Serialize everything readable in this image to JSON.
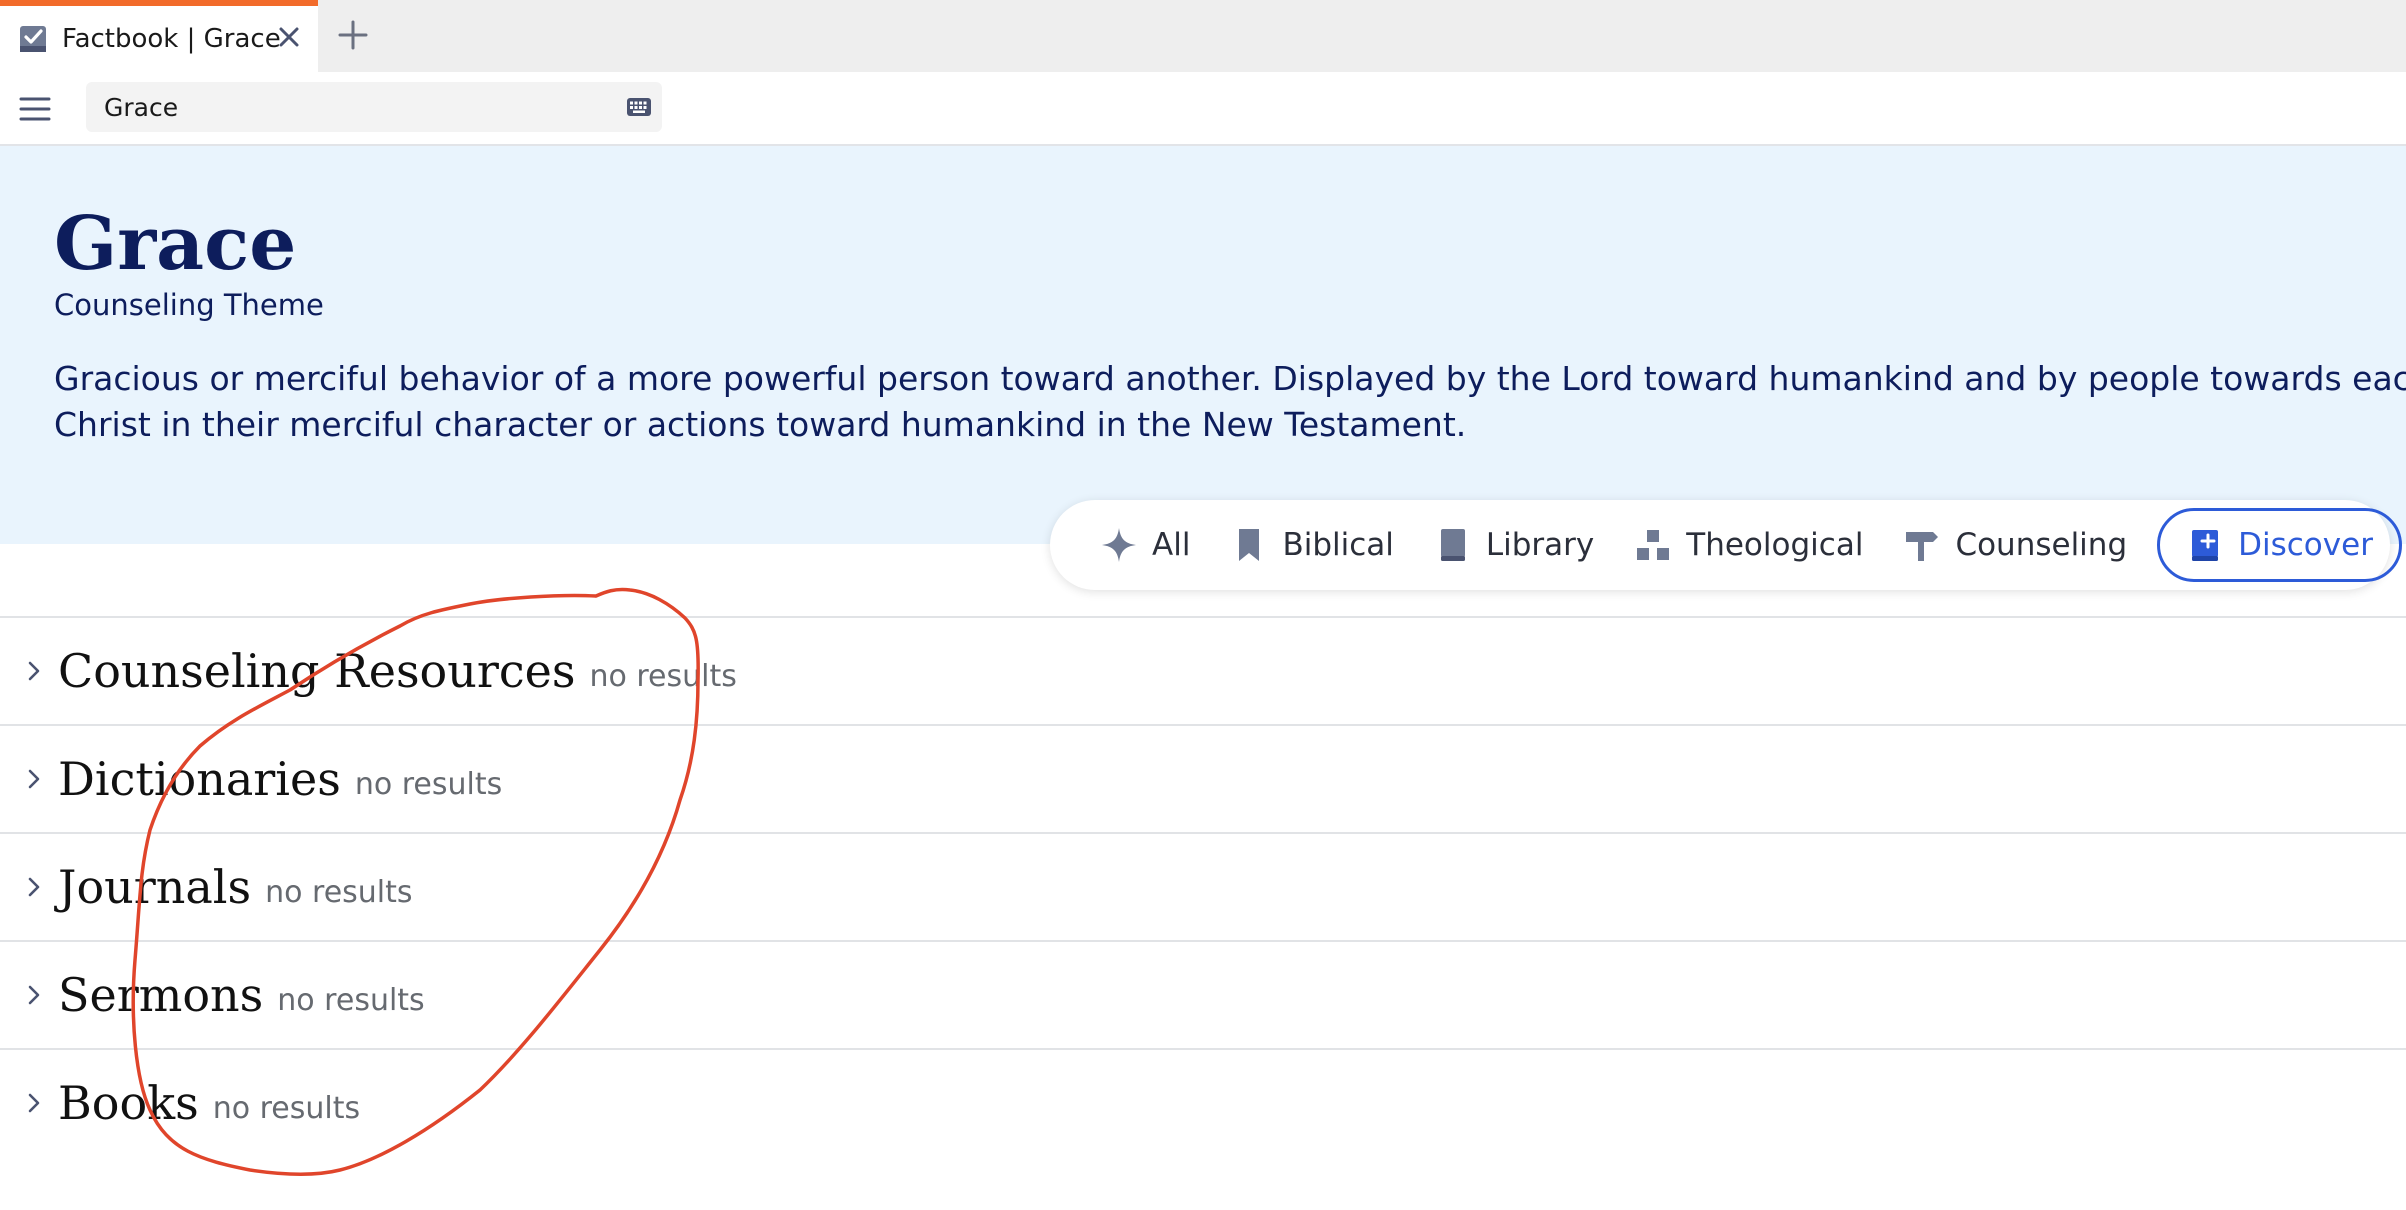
{
  "tab": {
    "title": "Factbook | Grace",
    "icon": "checkbox-app-icon",
    "accent": "#f26b2a"
  },
  "toolbar": {
    "search_value": "Grace",
    "menu_icon": "hamburger-menu-icon",
    "keyboard_icon": "keyboard-icon"
  },
  "header": {
    "title": "Grace",
    "subtitle": "Counseling Theme",
    "description_line1": "Gracious or merciful behavior of a more powerful person toward another. Displayed by the Lord toward humankind and by people towards each oth",
    "description_line2": "Christ in their merciful character or actions toward humankind in the New Testament.",
    "background": "#e9f4fd"
  },
  "filters": [
    {
      "label": "All",
      "icon": "sparkle-icon",
      "active": false
    },
    {
      "label": "Biblical",
      "icon": "bookmark-icon",
      "active": false
    },
    {
      "label": "Library",
      "icon": "book-icon",
      "active": false
    },
    {
      "label": "Theological",
      "icon": "blocks-icon",
      "active": false
    },
    {
      "label": "Counseling",
      "icon": "signpost-icon",
      "active": false
    },
    {
      "label": "Discover",
      "icon": "book-plus-icon",
      "active": true
    }
  ],
  "active_color": "#2d5bd8",
  "sections": [
    {
      "title": "Counseling Resources",
      "status": "no results"
    },
    {
      "title": "Dictionaries",
      "status": "no results"
    },
    {
      "title": "Journals",
      "status": "no results"
    },
    {
      "title": "Sermons",
      "status": "no results"
    },
    {
      "title": "Books",
      "status": "no results"
    }
  ],
  "annotation_color": "#e0452b"
}
